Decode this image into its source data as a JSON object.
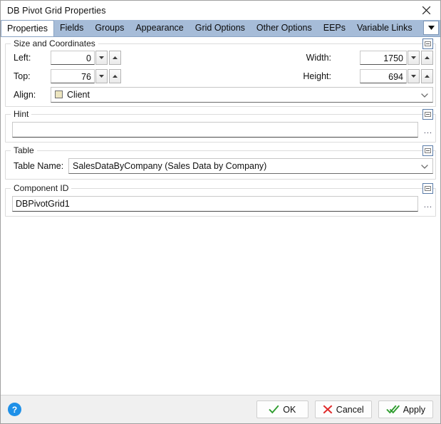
{
  "window": {
    "title": "DB Pivot Grid Properties",
    "close_icon": "close-icon"
  },
  "tabs": {
    "items": [
      {
        "label": "Properties",
        "active": true
      },
      {
        "label": "Fields",
        "active": false
      },
      {
        "label": "Groups",
        "active": false
      },
      {
        "label": "Appearance",
        "active": false
      },
      {
        "label": "Grid Options",
        "active": false
      },
      {
        "label": "Other Options",
        "active": false
      },
      {
        "label": "EEPs",
        "active": false
      },
      {
        "label": "Variable Links",
        "active": false
      }
    ],
    "overflow_icon": "chevron-down-icon"
  },
  "size_group": {
    "title": "Size and Coordinates",
    "left_label": "Left:",
    "left_value": "0",
    "top_label": "Top:",
    "top_value": "76",
    "width_label": "Width:",
    "width_value": "1750",
    "height_label": "Height:",
    "height_value": "694",
    "align_label": "Align:",
    "align_value": "Client",
    "align_swatch_color": "#ece5bf"
  },
  "hint_group": {
    "title": "Hint",
    "value": "",
    "placeholder": "",
    "browse_label": "..."
  },
  "table_group": {
    "title": "Table",
    "table_name_label": "Table Name:",
    "table_name_value": "SalesDataByCompany  (Sales Data by Company)"
  },
  "component_group": {
    "title": "Component ID",
    "value": "DBPivotGrid1",
    "browse_label": "..."
  },
  "footer": {
    "help_label": "?",
    "ok_label": "OK",
    "cancel_label": "Cancel",
    "apply_label": "Apply"
  },
  "colors": {
    "tabstrip": "#a6bcd8",
    "accent_blue": "#1e90e8",
    "ok_green": "#2e9c2e",
    "cancel_red": "#e02b2b"
  }
}
